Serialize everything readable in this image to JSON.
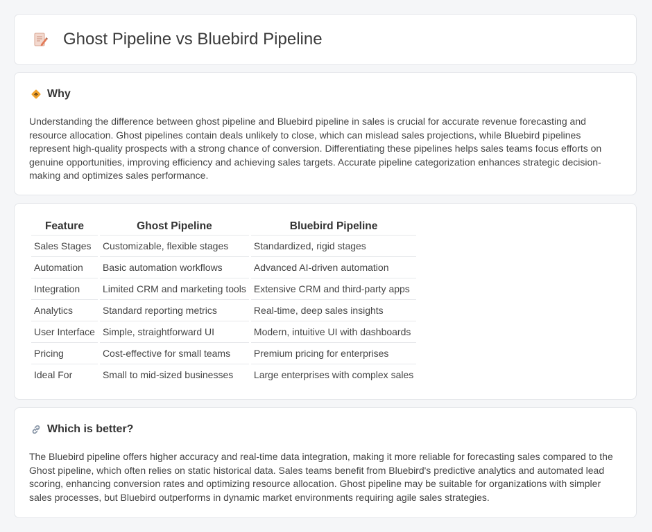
{
  "page": {
    "title": "Ghost Pipeline vs Bluebird Pipeline",
    "icon": "document-pencil-icon"
  },
  "why": {
    "heading": "Why",
    "icon": "diamond-sign-icon",
    "text": "Understanding the difference between ghost pipeline and Bluebird pipeline in sales is crucial for accurate revenue forecasting and resource allocation. Ghost pipelines contain deals unlikely to close, which can mislead sales projections, while Bluebird pipelines represent high-quality prospects with a strong chance of conversion. Differentiating these pipelines helps sales teams focus efforts on genuine opportunities, improving efficiency and achieving sales targets. Accurate pipeline categorization enhances strategic decision-making and optimizes sales performance."
  },
  "table": {
    "headers": [
      "Feature",
      "Ghost Pipeline",
      "Bluebird Pipeline"
    ],
    "rows": [
      [
        "Sales Stages",
        "Customizable, flexible stages",
        "Standardized, rigid stages"
      ],
      [
        "Automation",
        "Basic automation workflows",
        "Advanced AI-driven automation"
      ],
      [
        "Integration",
        "Limited CRM and marketing tools",
        "Extensive CRM and third-party apps"
      ],
      [
        "Analytics",
        "Standard reporting metrics",
        "Real-time, deep sales insights"
      ],
      [
        "User Interface",
        "Simple, straightforward UI",
        "Modern, intuitive UI with dashboards"
      ],
      [
        "Pricing",
        "Cost-effective for small teams",
        "Premium pricing for enterprises"
      ],
      [
        "Ideal For",
        "Small to mid-sized businesses",
        "Large enterprises with complex sales"
      ]
    ]
  },
  "better": {
    "heading": "Which is better?",
    "icon": "link-icon",
    "text": "The Bluebird pipeline offers higher accuracy and real-time data integration, making it more reliable for forecasting sales compared to the Ghost pipeline, which often relies on static historical data. Sales teams benefit from Bluebird's predictive analytics and automated lead scoring, enhancing conversion rates and optimizing resource allocation. Ghost pipeline may be suitable for organizations with simpler sales processes, but Bluebird outperforms in dynamic market environments requiring agile sales strategies."
  }
}
